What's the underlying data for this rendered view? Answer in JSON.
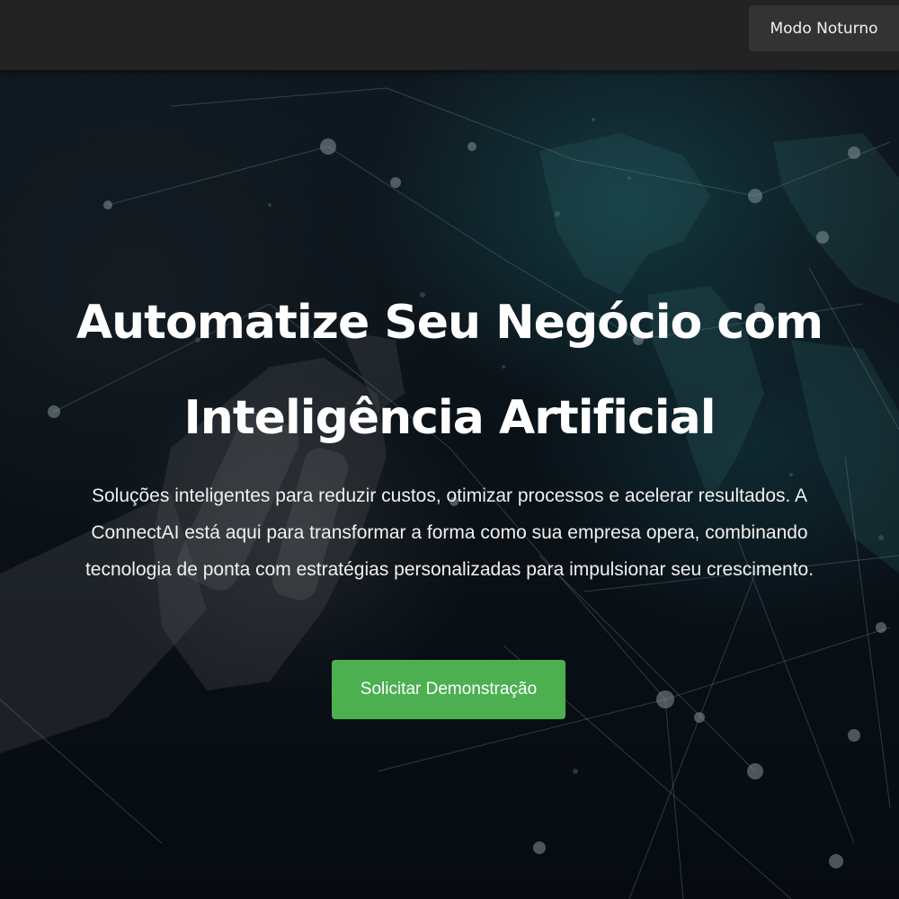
{
  "header": {
    "night_mode_label": "Modo Noturno"
  },
  "hero": {
    "title": "Automatize Seu Negócio com Inteligência Artificial",
    "description": "Soluções inteligentes para reduzir custos, otimizar processos e acelerar resultados. A ConnectAI está aqui para transformar a forma como sua empresa opera, combinando tecnologia de ponta com estratégias personalizadas para impulsionar seu crescimento.",
    "cta_label": "Solicitar Demonstração",
    "background_image": "ai-robot-hand-network-globe"
  },
  "colors": {
    "topbar": "#232323",
    "button_dark": "#333333",
    "cta_green": "#4cb050",
    "text": "#ffffff"
  }
}
